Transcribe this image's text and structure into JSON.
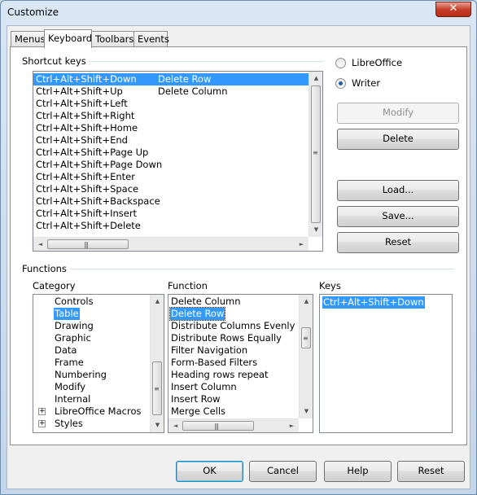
{
  "window": {
    "title": "Customize",
    "close_glyph": "✕"
  },
  "tabs": [
    "Menus",
    "Keyboard",
    "Toolbars",
    "Events"
  ],
  "shortcut_keys": {
    "label": "Shortcut keys",
    "rows": [
      {
        "key": "Ctrl+Alt+Shift+Down",
        "command": "Delete Row",
        "selected": true
      },
      {
        "key": "Ctrl+Alt+Shift+Up",
        "command": "Delete Column"
      },
      {
        "key": "Ctrl+Alt+Shift+Left",
        "command": ""
      },
      {
        "key": "Ctrl+Alt+Shift+Right",
        "command": ""
      },
      {
        "key": "Ctrl+Alt+Shift+Home",
        "command": ""
      },
      {
        "key": "Ctrl+Alt+Shift+End",
        "command": ""
      },
      {
        "key": "Ctrl+Alt+Shift+Page Up",
        "command": ""
      },
      {
        "key": "Ctrl+Alt+Shift+Page Down",
        "command": ""
      },
      {
        "key": "Ctrl+Alt+Shift+Enter",
        "command": ""
      },
      {
        "key": "Ctrl+Alt+Shift+Space",
        "command": ""
      },
      {
        "key": "Ctrl+Alt+Shift+Backspace",
        "command": ""
      },
      {
        "key": "Ctrl+Alt+Shift+Insert",
        "command": ""
      },
      {
        "key": "Ctrl+Alt+Shift+Delete",
        "command": ""
      }
    ]
  },
  "scope": {
    "libreoffice": "LibreOffice",
    "writer": "Writer",
    "selected": "Writer"
  },
  "side_buttons": {
    "modify": "Modify",
    "delete": "Delete",
    "load": "Load...",
    "save": "Save...",
    "reset": "Reset"
  },
  "functions": {
    "label": "Functions",
    "category_label": "Category",
    "function_label": "Function",
    "keys_label": "Keys",
    "categories": [
      {
        "name": "Controls"
      },
      {
        "name": "Table",
        "selected": true
      },
      {
        "name": "Drawing"
      },
      {
        "name": "Graphic"
      },
      {
        "name": "Data"
      },
      {
        "name": "Frame"
      },
      {
        "name": "Numbering"
      },
      {
        "name": "Modify"
      },
      {
        "name": "Internal"
      },
      {
        "name": "LibreOffice Macros",
        "expandable": true
      },
      {
        "name": "Styles",
        "expandable": true
      }
    ],
    "function_items": [
      {
        "name": "Delete Column"
      },
      {
        "name": "Delete Row",
        "selected": true
      },
      {
        "name": "Distribute Columns Evenly"
      },
      {
        "name": "Distribute Rows Equally"
      },
      {
        "name": "Filter Navigation"
      },
      {
        "name": "Form-Based Filters"
      },
      {
        "name": "Heading rows repeat"
      },
      {
        "name": "Insert Column"
      },
      {
        "name": "Insert Row"
      },
      {
        "name": "Merge Cells"
      }
    ],
    "keys": [
      "Ctrl+Alt+Shift+Down"
    ]
  },
  "footer": {
    "ok": "OK",
    "cancel": "Cancel",
    "help": "Help",
    "reset": "Reset"
  },
  "icons": {
    "scroll_up": "▲",
    "scroll_down": "▼",
    "scroll_left": "◄",
    "scroll_right": "►",
    "expand": "+"
  },
  "colors": {
    "selection": "#3399ff",
    "close_button": "#c7402b"
  }
}
